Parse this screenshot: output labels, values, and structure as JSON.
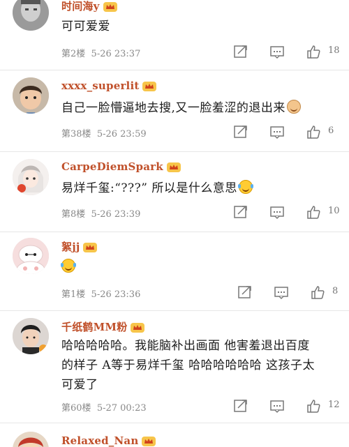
{
  "comments": [
    {
      "username": "时间海y",
      "content": "可可爱爱",
      "floor": "第2楼",
      "time": "5-26 23:37",
      "likes": "18",
      "avatar": "gray-face-avatar"
    },
    {
      "username": "xxxx_superlit",
      "content": "自己一脸懵逼地去搜,又一脸羞涩的退出来",
      "content_emoji": "cat-emoji",
      "floor": "第38楼",
      "time": "5-26 23:59",
      "likes": "6",
      "avatar": "child-avatar"
    },
    {
      "username": "CarpeDiemSpark",
      "content": "易烊千玺:“???” 所以是什么意思",
      "content_emoji": "laugh-cry-emoji",
      "floor": "第8楼",
      "time": "5-26 23:39",
      "likes": "10",
      "avatar": "anime-girl-avatar"
    },
    {
      "username": "絮jj",
      "content": "",
      "content_emoji": "laugh-cry-emoji",
      "floor": "第1楼",
      "time": "5-26 23:36",
      "likes": "8",
      "avatar": "baymax-avatar"
    },
    {
      "username": "千纸鹤MM粉",
      "content": "哈哈哈哈哈。我能脑补出画面 他害羞退出百度的样子 A等于易烊千玺 哈哈哈哈哈哈 这孩子太可爱了",
      "floor": "第60楼",
      "time": "5-27 00:23",
      "likes": "12",
      "avatar": "young-man-avatar"
    },
    {
      "username": "Relaxed_Nan",
      "avatar": "cartoon-avatar"
    }
  ],
  "colors": {
    "username": "#c0502a",
    "meta": "#888888",
    "crown": "#f0a030"
  }
}
